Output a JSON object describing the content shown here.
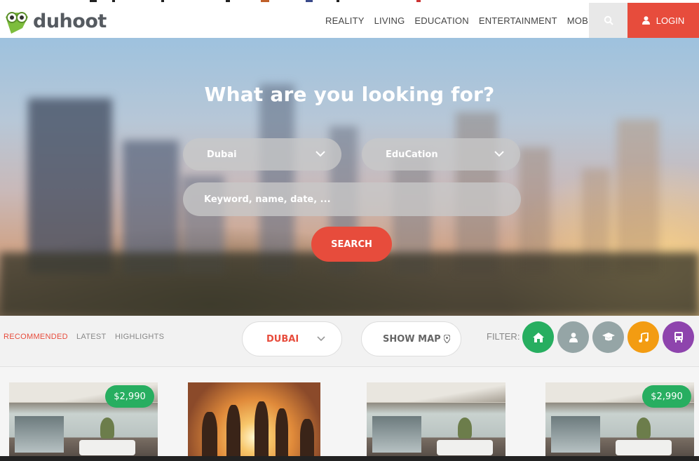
{
  "brand": {
    "name": "duhoot"
  },
  "nav": {
    "items": [
      "REALITY",
      "LIVING",
      "EDUCATION",
      "ENTERTAINMENT",
      "MOBILITY"
    ],
    "login": "LOGIN"
  },
  "hero": {
    "title": "What are you looking for?",
    "city_select": "Dubai",
    "category_select": "EduCation",
    "keyword_placeholder": "Keyword, name, date, ...",
    "search_label": "SEARCH"
  },
  "filterbar": {
    "tabs": [
      "RECOMMENDED",
      "LATEST",
      "HIGHLIGHTS"
    ],
    "city": "DUBAI",
    "show_map": "SHOW MAP",
    "filter_label": "FILTER:",
    "filters": [
      {
        "icon": "home-icon",
        "color": "#27ae60"
      },
      {
        "icon": "user-icon",
        "color": "#95a5a6"
      },
      {
        "icon": "graduation-cap-icon",
        "color": "#95a5a6"
      },
      {
        "icon": "music-icon",
        "color": "#f39c12"
      },
      {
        "icon": "bus-icon",
        "color": "#8e44ad"
      }
    ]
  },
  "cards": [
    {
      "price": "$2,990",
      "image": "villa"
    },
    {
      "price": "",
      "image": "party"
    },
    {
      "price": "",
      "image": "villa"
    },
    {
      "price": "$2,990",
      "image": "villa"
    }
  ],
  "colors": {
    "accent": "#e74c3c",
    "green": "#27ae60",
    "text": "#444444"
  }
}
